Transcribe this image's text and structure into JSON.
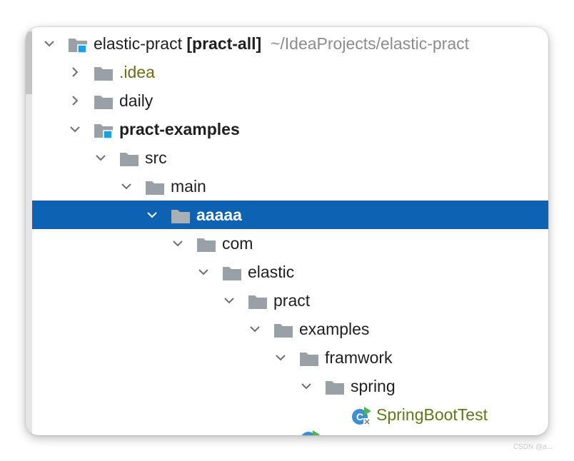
{
  "tree": {
    "root": {
      "name": "elastic-pract",
      "module": "[pract-all]",
      "path": "~/IdeaProjects/elastic-pract"
    },
    "items": [
      {
        "label": ".idea"
      },
      {
        "label": "daily"
      },
      {
        "label": "pract-examples"
      },
      {
        "label": "src"
      },
      {
        "label": "main"
      },
      {
        "label": "aaaaa"
      },
      {
        "label": "com"
      },
      {
        "label": "elastic"
      },
      {
        "label": "pract"
      },
      {
        "label": "examples"
      },
      {
        "label": "framwork"
      },
      {
        "label": "spring"
      },
      {
        "label": "SpringBootTest"
      }
    ],
    "selected": "aaaaa"
  },
  "colors": {
    "selection": "#0d62b3",
    "folder": "#9aa1a6",
    "module_marker": "#1aa3e0",
    "excluded_text": "#6f6a15",
    "test_text": "#5d7a18"
  },
  "icons": [
    "chevron-down-icon",
    "chevron-right-icon",
    "folder-icon",
    "module-folder-icon",
    "spring-test-class-icon"
  ],
  "watermark": "CSDN @a..."
}
